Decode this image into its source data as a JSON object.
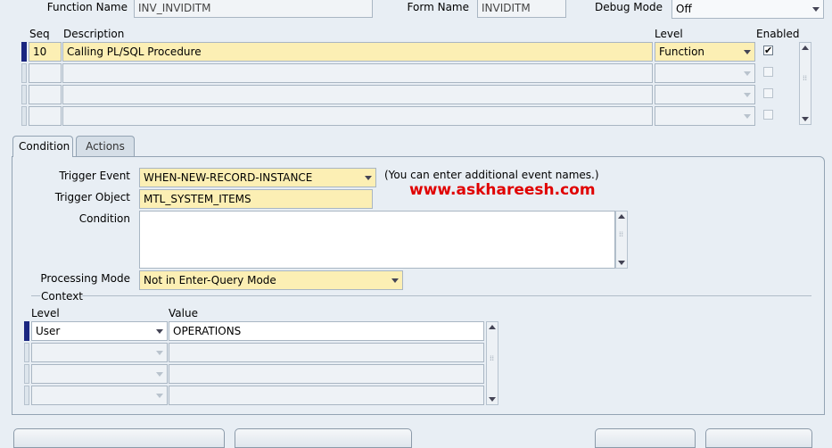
{
  "header": {
    "function_name_label": "Function Name",
    "function_name_value": "INV_INVIDITM",
    "form_name_label": "Form Name",
    "form_name_value": "INVIDITM",
    "debug_mode_label": "Debug Mode",
    "debug_mode_value": "Off"
  },
  "grid": {
    "columns": {
      "seq": "Seq",
      "description": "Description",
      "level": "Level",
      "enabled": "Enabled"
    },
    "rows": [
      {
        "seq": "10",
        "description": "Calling PL/SQL Procedure",
        "level": "Function",
        "enabled": true
      },
      {
        "seq": "",
        "description": "",
        "level": "",
        "enabled": false
      },
      {
        "seq": "",
        "description": "",
        "level": "",
        "enabled": false
      },
      {
        "seq": "",
        "description": "",
        "level": "",
        "enabled": false
      }
    ]
  },
  "tabs": [
    {
      "label": "Condition",
      "active": true
    },
    {
      "label": "Actions",
      "active": false
    }
  ],
  "condition": {
    "trigger_event_label": "Trigger Event",
    "trigger_event_value": "WHEN-NEW-RECORD-INSTANCE",
    "trigger_event_hint": "(You can enter additional event names.)",
    "trigger_object_label": "Trigger Object",
    "trigger_object_value": "MTL_SYSTEM_ITEMS",
    "condition_label": "Condition",
    "condition_value": "",
    "processing_mode_label": "Processing Mode",
    "processing_mode_value": "Not in Enter-Query Mode"
  },
  "watermark": "www.askhareesh.com",
  "context": {
    "title": "Context",
    "columns": {
      "level": "Level",
      "value": "Value"
    },
    "rows": [
      {
        "level": "User",
        "value": "OPERATIONS"
      },
      {
        "level": "",
        "value": ""
      },
      {
        "level": "",
        "value": ""
      },
      {
        "level": "",
        "value": ""
      }
    ]
  },
  "colors": {
    "required_field": "#fcefb4",
    "current_record": "#1a2680",
    "watermark": "#e00000"
  }
}
